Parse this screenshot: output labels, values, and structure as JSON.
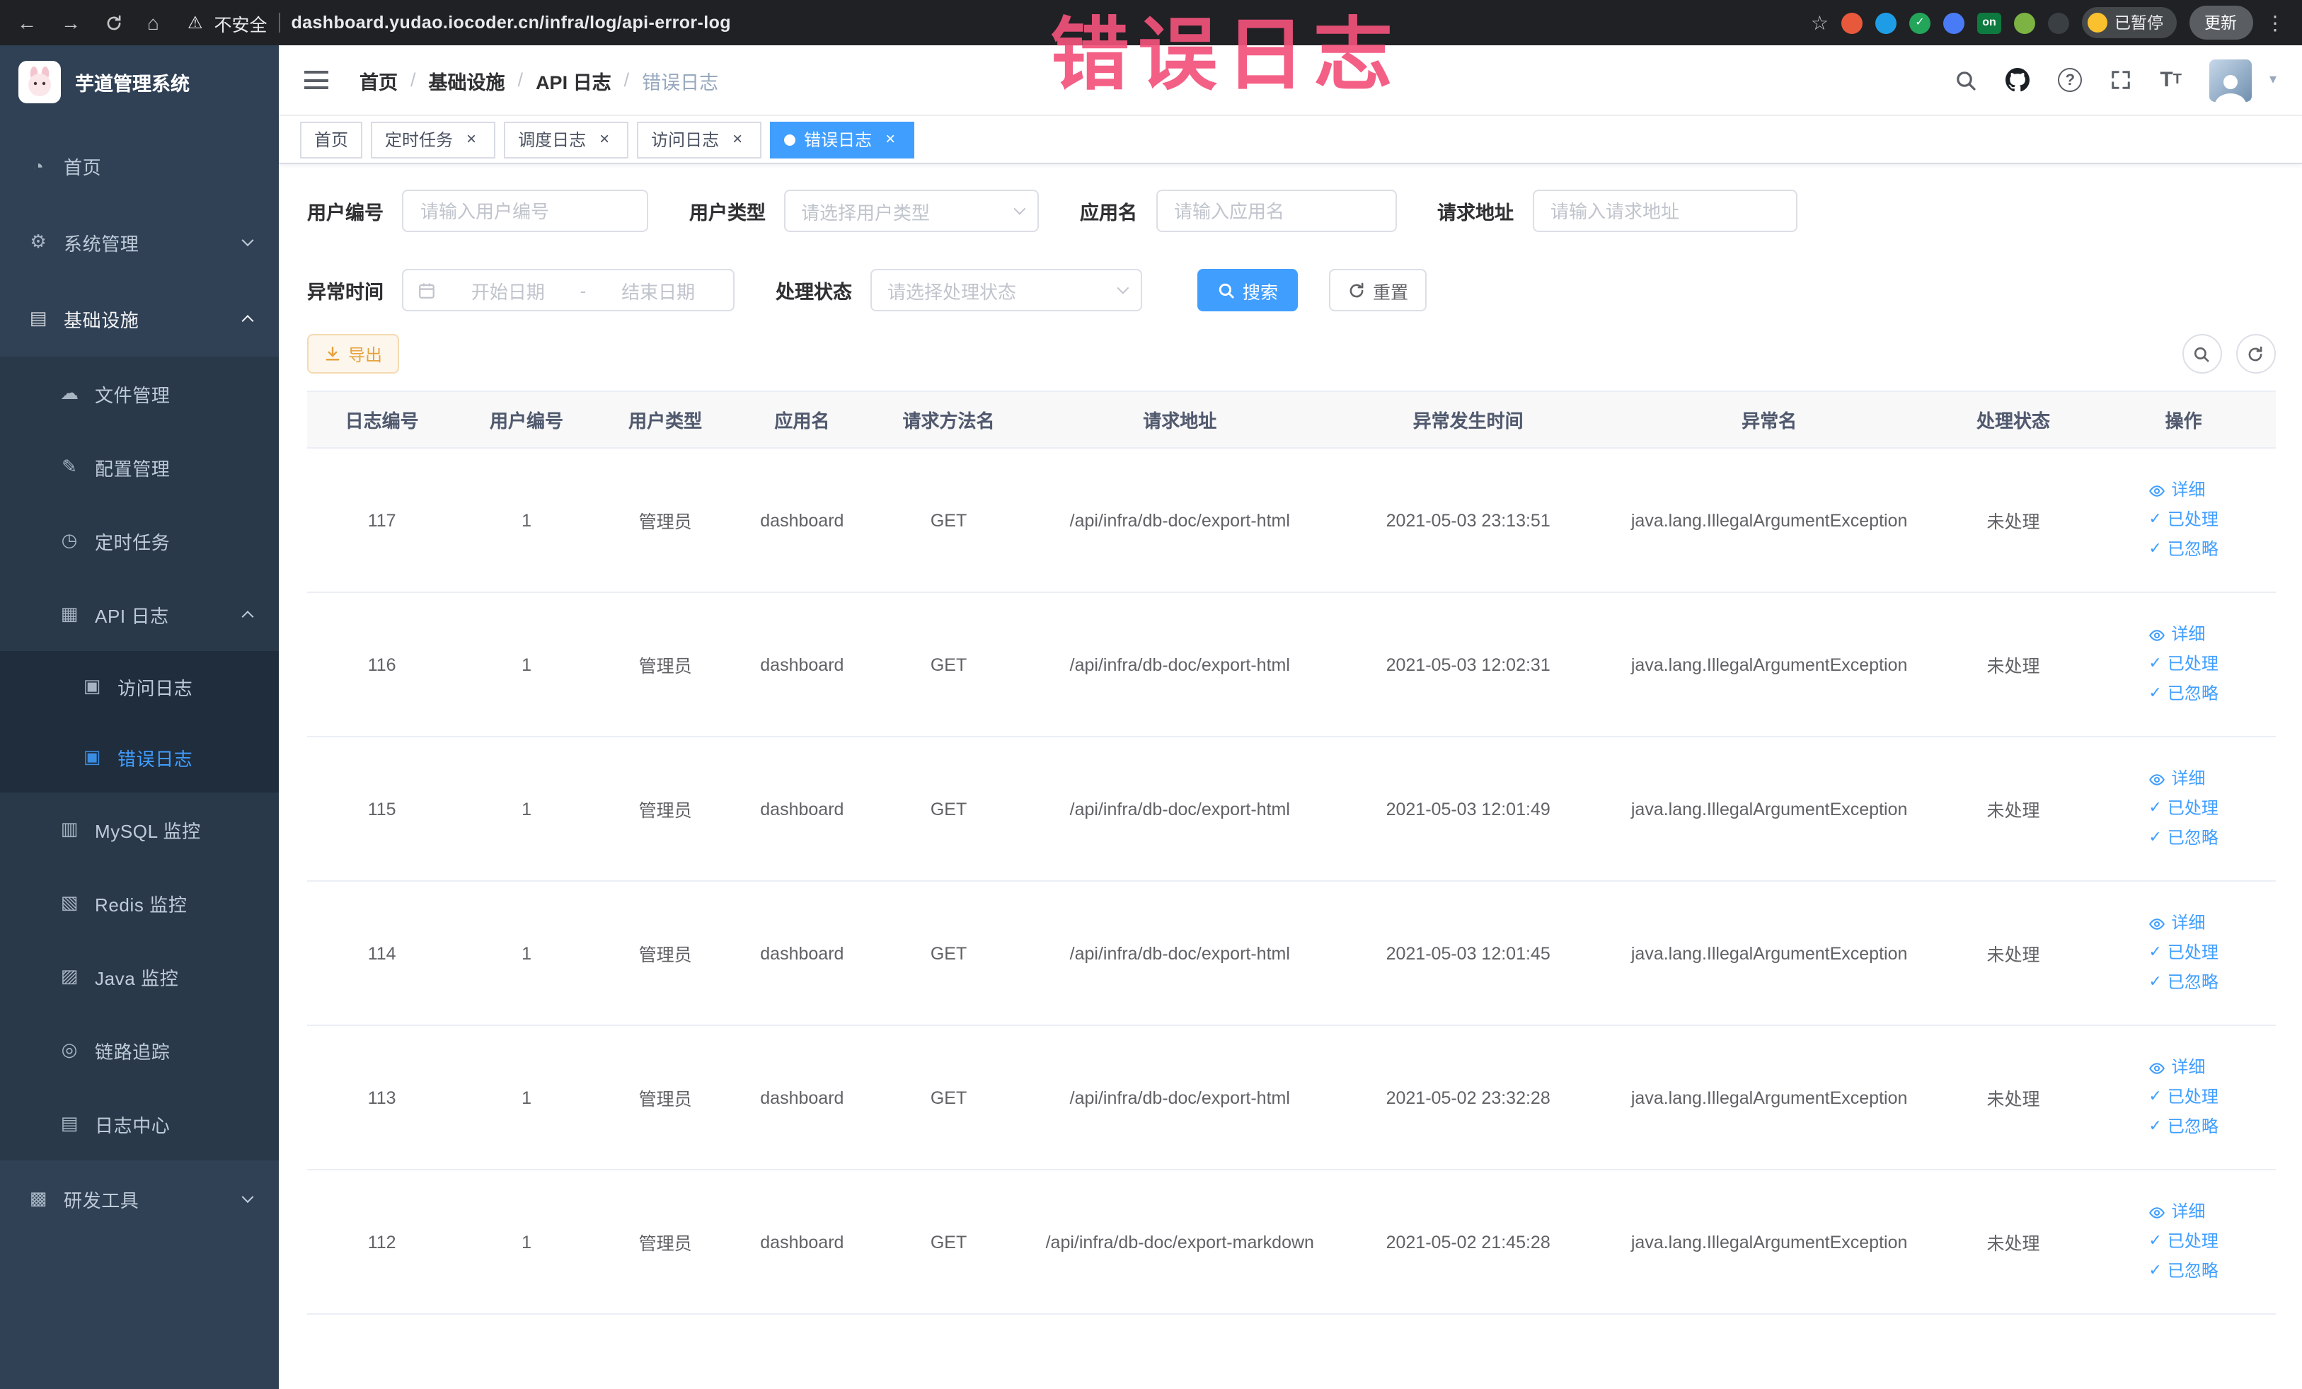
{
  "theme": {
    "accent": "#409eff",
    "sidebar_bg": "#304156",
    "warning_text": "#e6a23c",
    "annotation_color": "#f2527b"
  },
  "annotation": {
    "text": "错误日志"
  },
  "ui": {
    "breadcrumb_sep": "/",
    "close_glyph": "×",
    "check_glyph": "✓",
    "caret_glyph": "▾",
    "help_glyph": "?",
    "font_size_glyph": "T"
  },
  "browser": {
    "back_glyph": "←",
    "forward_glyph": "→",
    "home_glyph": "⌂",
    "warning_glyph": "⚠",
    "security_label": "不安全",
    "url": "dashboard.yudao.iocoder.cn/infra/log/api-error-log",
    "star_glyph": "☆",
    "kebab_glyph": "⋮",
    "paused_label": "已暂停",
    "update_label": "更新",
    "extensions": [
      {
        "name": "extension-icon-orange",
        "style": "background:#e8593c"
      },
      {
        "name": "extension-icon-blue-drop",
        "style": "background:#1e9de6"
      },
      {
        "name": "extension-icon-green-check",
        "style": "background:#23a55a",
        "glyph": "✓"
      },
      {
        "name": "extension-icon-blue-grid",
        "style": "background:#4a7bf7"
      },
      {
        "name": "extension-icon-on-switch",
        "style": "background:#0d7a3f",
        "glyph": "on",
        "square": true
      },
      {
        "name": "extension-icon-leaf",
        "style": "background:#7cb342"
      },
      {
        "name": "extension-icon-paw",
        "style": "background:#3a3f44"
      }
    ]
  },
  "sidebar": {
    "logo_title": "芋道管理系统",
    "items": [
      {
        "label": "首页",
        "level": "1",
        "glyph": "◔",
        "item_name": "sidebar-item-home",
        "icon_name": "dashboard-icon"
      },
      {
        "label": "系统管理",
        "level": "1",
        "glyph": "⚙",
        "chevron_down": true,
        "item_name": "sidebar-item-system-mgmt",
        "icon_name": "gear-icon"
      },
      {
        "label": "基础设施",
        "level": "1",
        "glyph": "▤",
        "chevron_up": true,
        "open": true,
        "item_name": "sidebar-item-infrastructure",
        "icon_name": "monitor-icon"
      },
      {
        "label": "文件管理",
        "level": "2",
        "glyph": "☁",
        "item_name": "sidebar-item-file-mgmt",
        "icon_name": "cloud-upload-icon"
      },
      {
        "label": "配置管理",
        "level": "2",
        "glyph": "✎",
        "item_name": "sidebar-item-config-mgmt",
        "icon_name": "edit-icon"
      },
      {
        "label": "定时任务",
        "level": "2",
        "glyph": "◷",
        "item_name": "sidebar-item-scheduled-jobs",
        "icon_name": "clock-icon"
      },
      {
        "label": "API 日志",
        "level": "2",
        "glyph": "▦",
        "chevron_up": true,
        "item_name": "sidebar-item-api-logs",
        "icon_name": "log-icon"
      },
      {
        "label": "访问日志",
        "level": "3",
        "glyph": "▣",
        "item_name": "sidebar-item-access-log",
        "icon_name": "document-icon"
      },
      {
        "label": "错误日志",
        "level": "3",
        "glyph": "▣",
        "active": true,
        "item_name": "sidebar-item-error-log",
        "icon_name": "document-icon"
      },
      {
        "label": "MySQL 监控",
        "level": "2",
        "glyph": "▥",
        "item_name": "sidebar-item-mysql-monitor",
        "icon_name": "database-icon"
      },
      {
        "label": "Redis 监控",
        "level": "2",
        "glyph": "▧",
        "item_name": "sidebar-item-redis-monitor",
        "icon_name": "database-icon"
      },
      {
        "label": "Java 监控",
        "level": "2",
        "glyph": "▨",
        "item_name": "sidebar-item-java-monitor",
        "icon_name": "coffee-icon"
      },
      {
        "label": "链路追踪",
        "level": "2",
        "glyph": "◎",
        "item_name": "sidebar-item-trace",
        "icon_name": "eye-icon"
      },
      {
        "label": "日志中心",
        "level": "2",
        "glyph": "▤",
        "item_name": "sidebar-item-log-center",
        "icon_name": "list-icon"
      },
      {
        "label": "研发工具",
        "level": "1",
        "glyph": "▩",
        "chevron_down": true,
        "item_name": "sidebar-item-dev-tools",
        "icon_name": "tools-icon"
      }
    ]
  },
  "header": {
    "breadcrumb": [
      "首页",
      "基础设施",
      "API 日志",
      "错误日志"
    ]
  },
  "tabs": [
    {
      "label": "首页"
    },
    {
      "label": "定时任务",
      "closable": true
    },
    {
      "label": "调度日志",
      "closable": true
    },
    {
      "label": "访问日志",
      "closable": true
    },
    {
      "label": "错误日志",
      "closable": true,
      "active": true
    }
  ],
  "filters": {
    "user_id": {
      "label": "用户编号",
      "placeholder": "请输入用户编号"
    },
    "user_type": {
      "label": "用户类型",
      "placeholder": "请选择用户类型"
    },
    "app_name": {
      "label": "应用名",
      "placeholder": "请输入应用名"
    },
    "request_url": {
      "label": "请求地址",
      "placeholder": "请输入请求地址"
    },
    "exception_time": {
      "label": "异常时间",
      "start_placeholder": "开始日期",
      "separator": "-",
      "end_placeholder": "结束日期"
    },
    "status": {
      "label": "处理状态",
      "placeholder": "请选择处理状态"
    },
    "search_button": "搜索",
    "reset_button": "重置"
  },
  "toolbar": {
    "export_label": "导出"
  },
  "table": {
    "columns": [
      "日志编号",
      "用户编号",
      "用户类型",
      "应用名",
      "请求方法名",
      "请求地址",
      "异常发生时间",
      "异常名",
      "处理状态",
      "操作"
    ],
    "actions": {
      "detail": "详细",
      "processed": "已处理",
      "ignored": "已忽略"
    },
    "rows": [
      {
        "id": "117",
        "user_id": "1",
        "user_type": "管理员",
        "app": "dashboard",
        "method": "GET",
        "url": "/api/infra/db-doc/export-html",
        "time": "2021-05-03 23:13:51",
        "exception": "java.lang.IllegalArgumentException",
        "status": "未处理"
      },
      {
        "id": "116",
        "user_id": "1",
        "user_type": "管理员",
        "app": "dashboard",
        "method": "GET",
        "url": "/api/infra/db-doc/export-html",
        "time": "2021-05-03 12:02:31",
        "exception": "java.lang.IllegalArgumentException",
        "status": "未处理"
      },
      {
        "id": "115",
        "user_id": "1",
        "user_type": "管理员",
        "app": "dashboard",
        "method": "GET",
        "url": "/api/infra/db-doc/export-html",
        "time": "2021-05-03 12:01:49",
        "exception": "java.lang.IllegalArgumentException",
        "status": "未处理"
      },
      {
        "id": "114",
        "user_id": "1",
        "user_type": "管理员",
        "app": "dashboard",
        "method": "GET",
        "url": "/api/infra/db-doc/export-html",
        "time": "2021-05-03 12:01:45",
        "exception": "java.lang.IllegalArgumentException",
        "status": "未处理"
      },
      {
        "id": "113",
        "user_id": "1",
        "user_type": "管理员",
        "app": "dashboard",
        "method": "GET",
        "url": "/api/infra/db-doc/export-html",
        "time": "2021-05-02 23:32:28",
        "exception": "java.lang.IllegalArgumentException",
        "status": "未处理"
      },
      {
        "id": "112",
        "user_id": "1",
        "user_type": "管理员",
        "app": "dashboard",
        "method": "GET",
        "url": "/api/infra/db-doc/export-markdown",
        "time": "2021-05-02 21:45:28",
        "exception": "java.lang.IllegalArgumentException",
        "status": "未处理"
      }
    ]
  }
}
